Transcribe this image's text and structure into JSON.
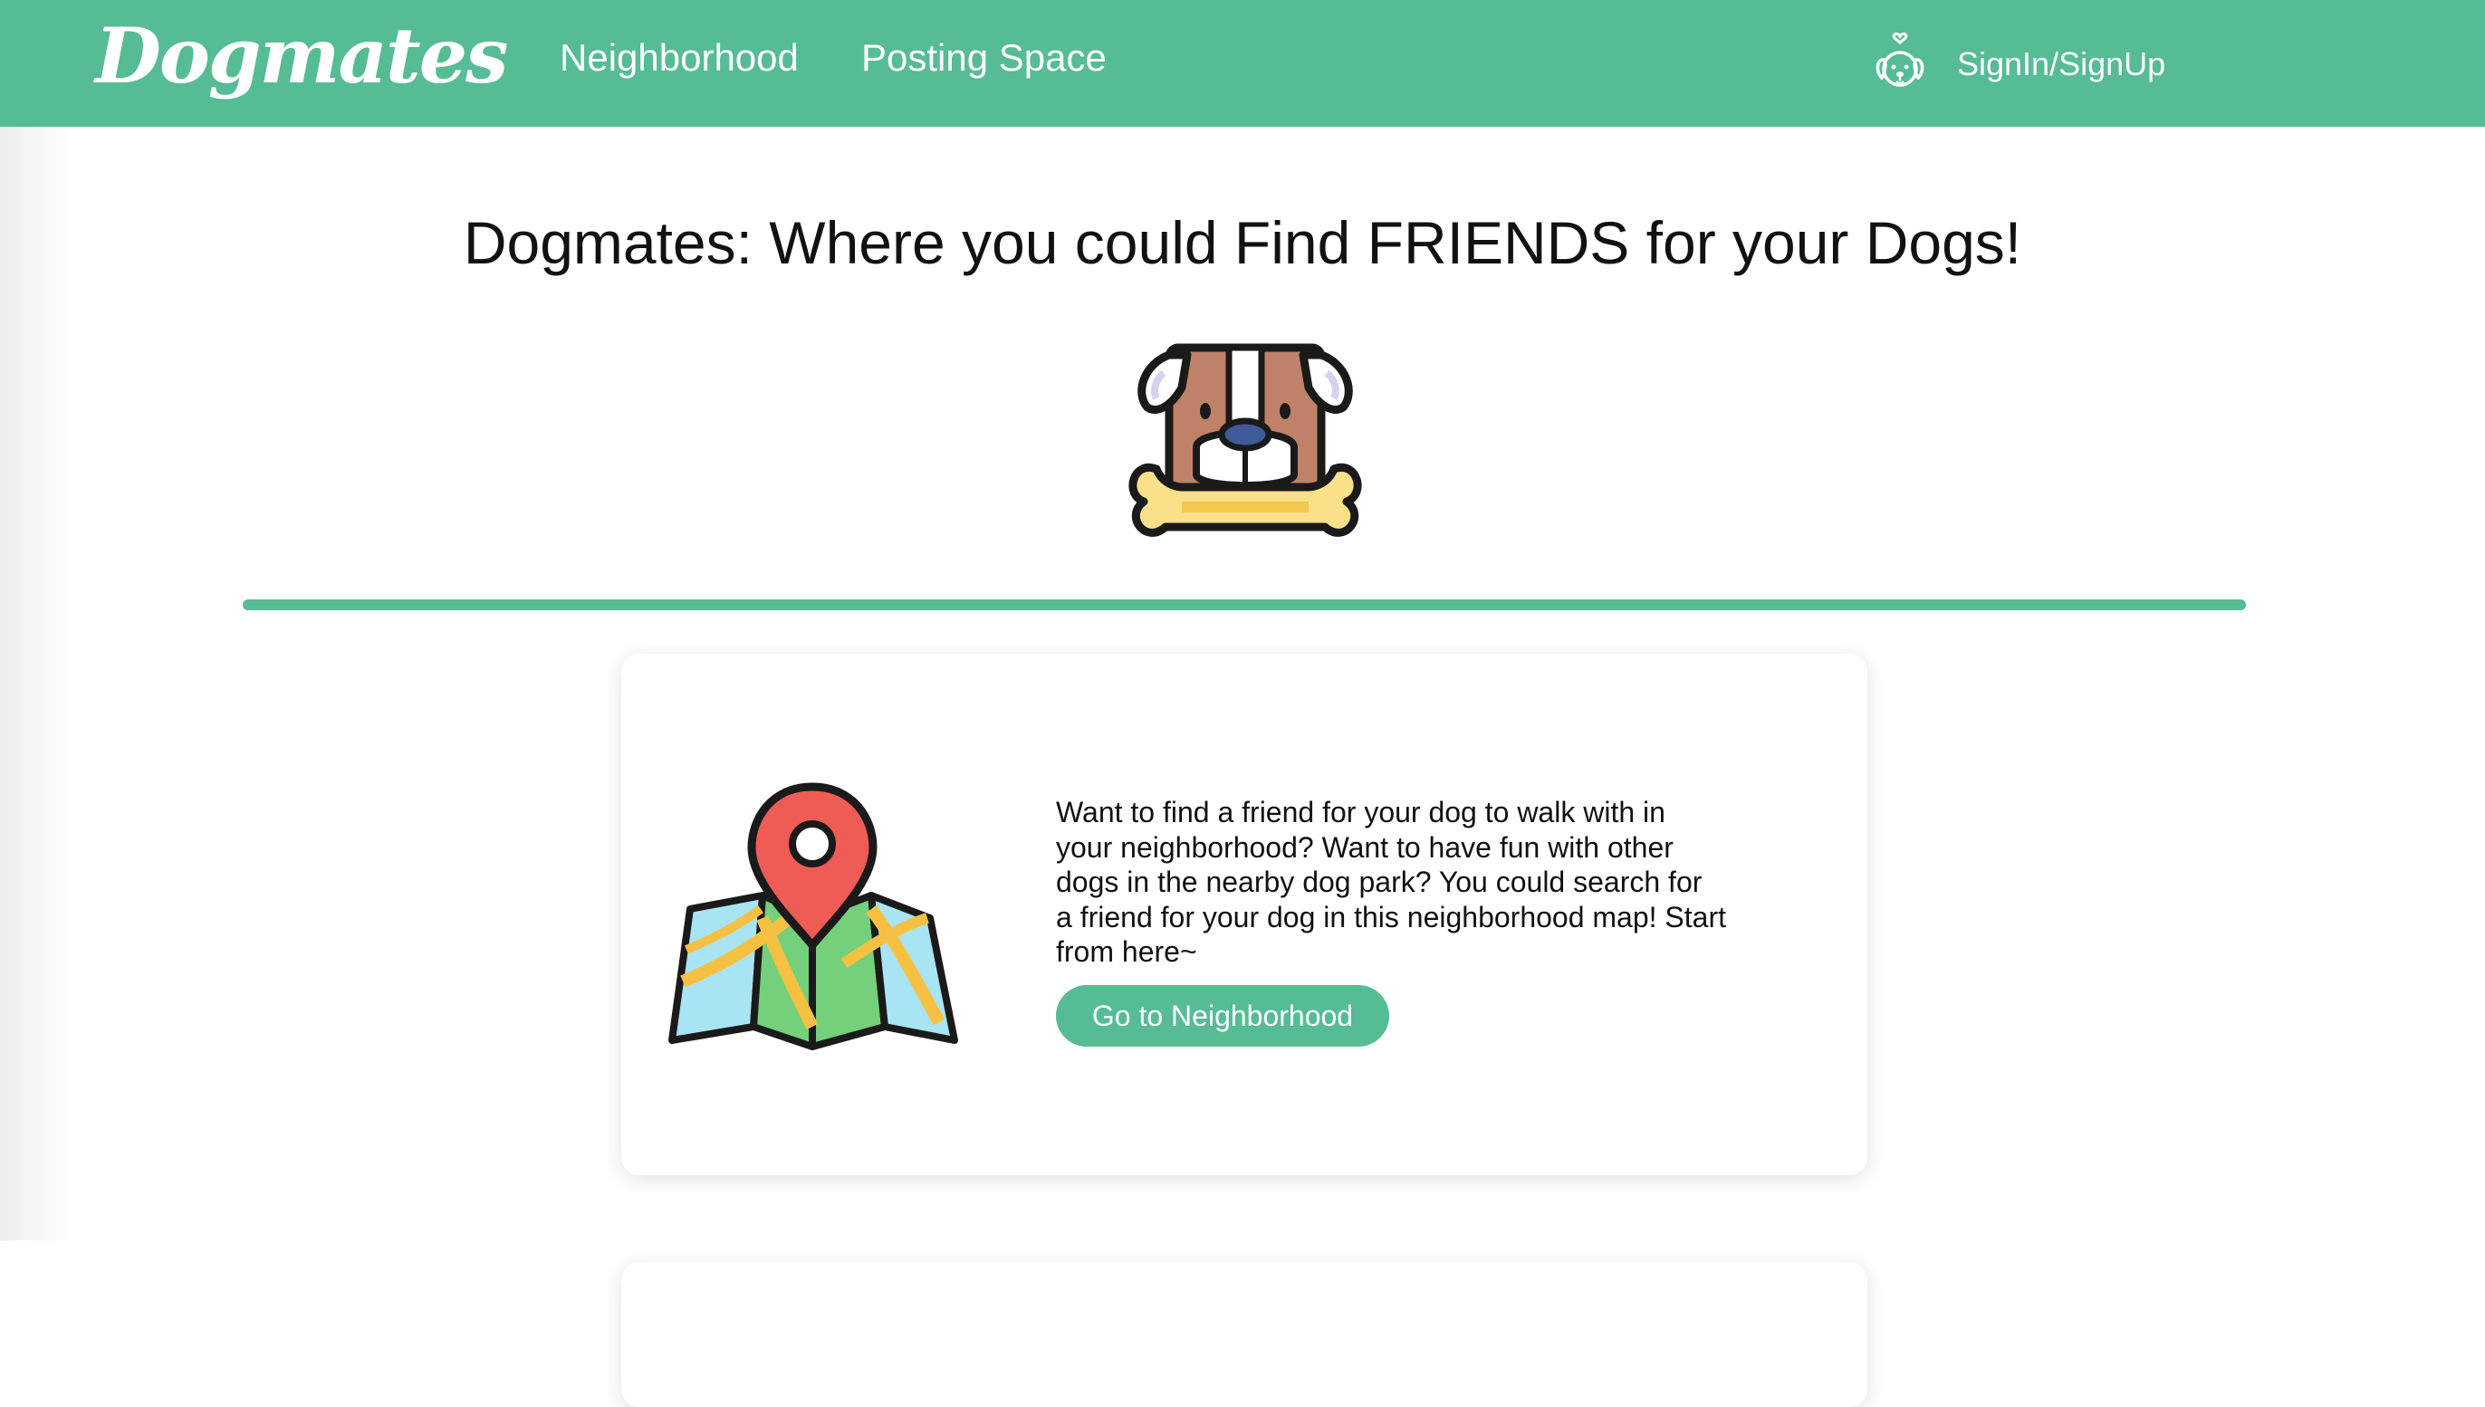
{
  "navbar": {
    "brand": "Dogmates",
    "links": [
      {
        "label": "Neighborhood"
      },
      {
        "label": "Posting Space"
      }
    ],
    "signin": {
      "label": "SignIn/SignUp",
      "icon": "dog-face-icon"
    },
    "background_color": "#56bc94"
  },
  "main": {
    "title": "Dogmates: Where you could Find FRIENDS for your Dogs!",
    "hero_icon": "dog-with-bone-icon",
    "accent_color": "#56bc94"
  },
  "cards": [
    {
      "icon": "map-pin-icon",
      "description": "Want to find a friend for your dog to walk with in your neighborhood? Want to have fun with other dogs in the nearby dog park? You could search for a friend for your dog in this neighborhood map! Start from here~",
      "button_label": "Go to Neighborhood"
    }
  ]
}
